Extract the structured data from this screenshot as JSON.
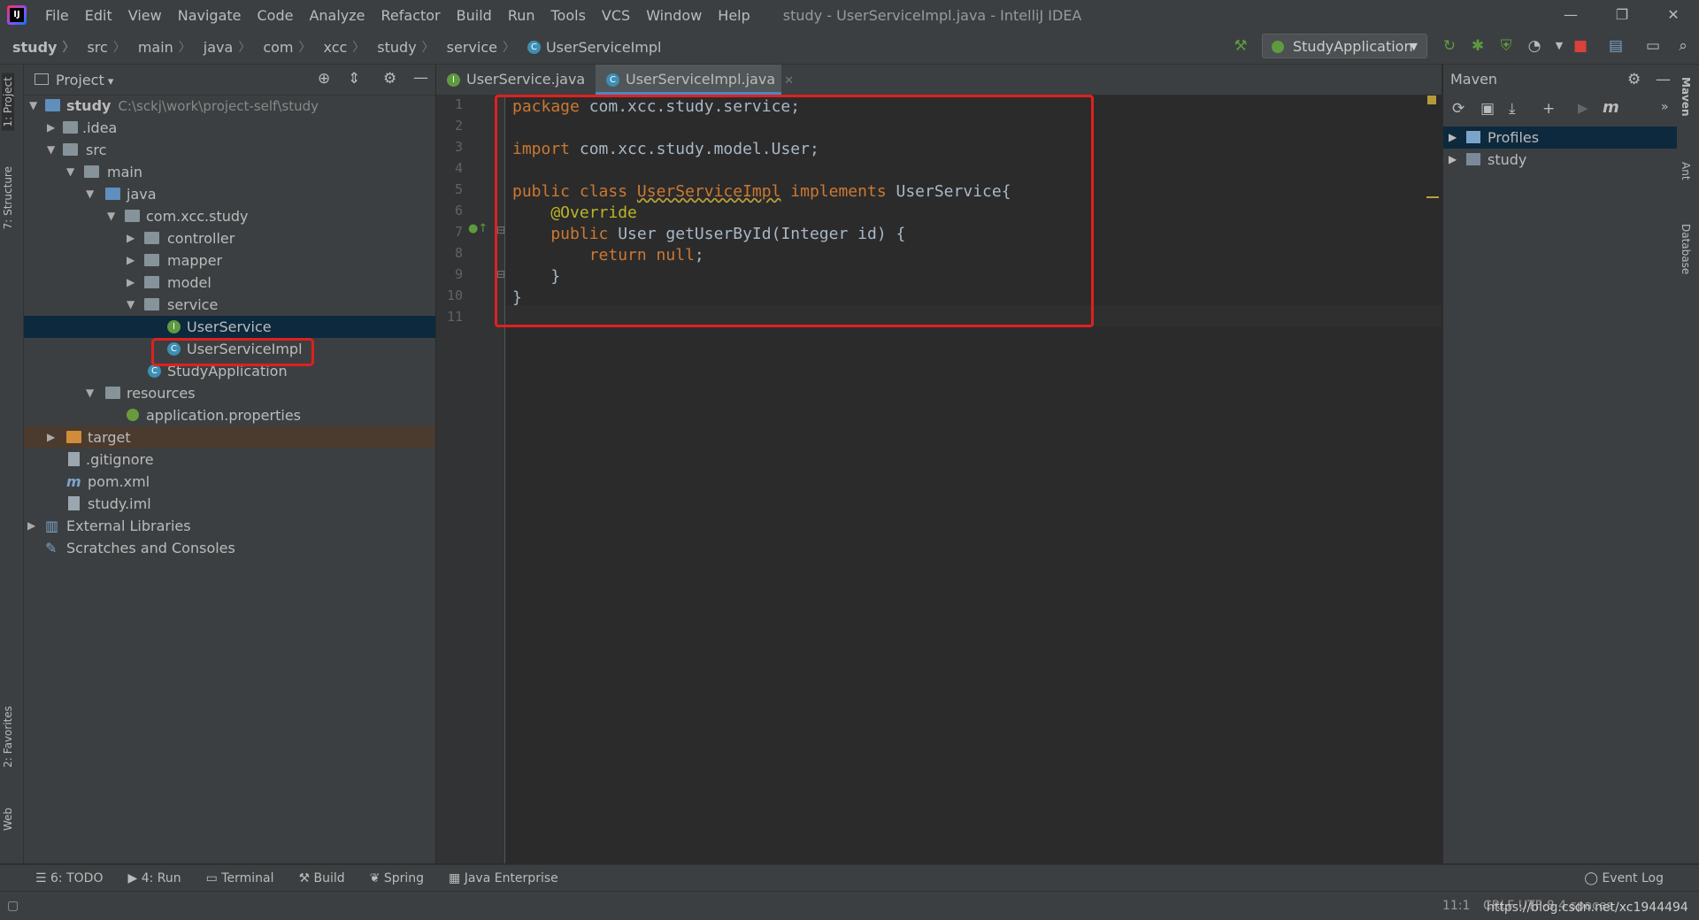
{
  "app": {
    "window_title": "study - UserServiceImpl.java - IntelliJ IDEA",
    "menu": [
      "File",
      "Edit",
      "View",
      "Navigate",
      "Code",
      "Analyze",
      "Refactor",
      "Build",
      "Run",
      "Tools",
      "VCS",
      "Window",
      "Help"
    ]
  },
  "breadcrumb": [
    "study",
    "src",
    "main",
    "java",
    "com",
    "xcc",
    "study",
    "service",
    "UserServiceImpl"
  ],
  "toolbar": {
    "run_config": "StudyApplication"
  },
  "project_panel": {
    "title": "Project",
    "tree": [
      {
        "label": "study",
        "path": "C:\\sckj\\work\\project-self\\study"
      },
      {
        "label": ".idea"
      },
      {
        "label": "src"
      },
      {
        "label": "main"
      },
      {
        "label": "java"
      },
      {
        "label": "com.xcc.study"
      },
      {
        "label": "controller"
      },
      {
        "label": "mapper"
      },
      {
        "label": "model"
      },
      {
        "label": "service"
      },
      {
        "label": "UserService"
      },
      {
        "label": "UserServiceImpl"
      },
      {
        "label": "StudyApplication"
      },
      {
        "label": "resources"
      },
      {
        "label": "application.properties"
      },
      {
        "label": "target"
      },
      {
        "label": ".gitignore"
      },
      {
        "label": "pom.xml"
      },
      {
        "label": "study.iml"
      },
      {
        "label": "External Libraries"
      },
      {
        "label": "Scratches and Consoles"
      }
    ]
  },
  "editor": {
    "tabs": [
      {
        "label": "UserService.java",
        "active": false
      },
      {
        "label": "UserServiceImpl.java",
        "active": true
      }
    ],
    "line_numbers": [
      "1",
      "2",
      "3",
      "4",
      "5",
      "6",
      "7",
      "8",
      "9",
      "10",
      "11"
    ],
    "code": {
      "l1_kw": "package",
      "l1_rest": " com.xcc.study.service;",
      "l3_kw": "import",
      "l3_rest": " com.xcc.study.model.User;",
      "l5_kw1": "public class ",
      "l5_name": "UserServiceImpl",
      "l5_kw2": " implements ",
      "l5_rest": "UserService{",
      "l6_ann": "    @Override",
      "l7_kw": "    public ",
      "l7_rest": "User getUserById(Integer id) {",
      "l8_kw": "        return null",
      "l8_rest": ";",
      "l9": "    }",
      "l10": "}"
    }
  },
  "maven_panel": {
    "title": "Maven",
    "items": [
      "Profiles",
      "study"
    ]
  },
  "left_stripe": [
    "1: Project",
    "7: Structure",
    "2: Favorites",
    "Web"
  ],
  "right_stripe": [
    "Maven",
    "Ant",
    "Database"
  ],
  "bottom_tools": [
    "6: TODO",
    "4: Run",
    "Terminal",
    "Build",
    "Spring",
    "Java Enterprise"
  ],
  "status": {
    "event_log": "Event Log",
    "position": "11:1",
    "encoding": "CRLF  UTF-8  4 spaces",
    "watermark": "https://blog.csdn.net/xc1944494"
  }
}
